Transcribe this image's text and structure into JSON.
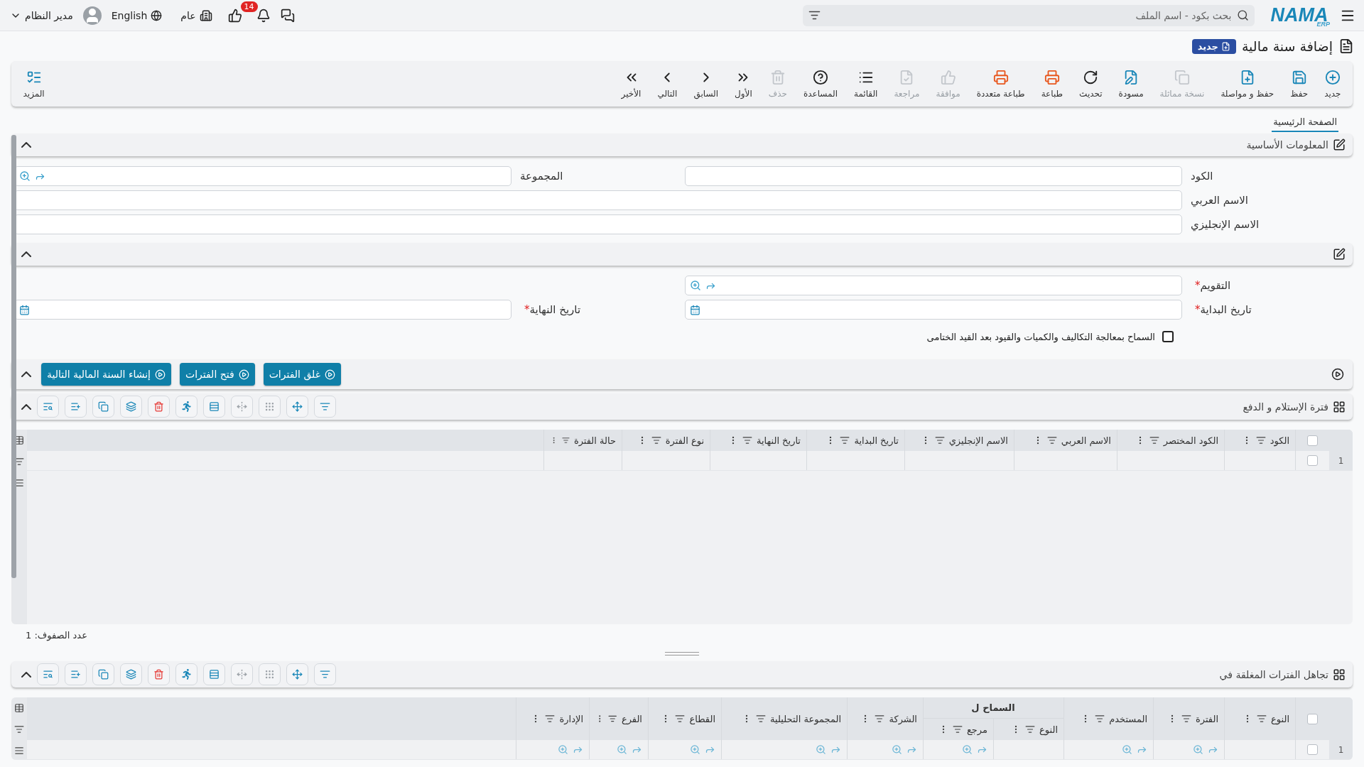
{
  "topbar": {
    "logo": "NAMA",
    "logo_sub": "ERP",
    "search_placeholder": "بحث بكود - اسم الملف",
    "notification_count": "14",
    "company": "عام",
    "language": "English",
    "user": "مدير النظام"
  },
  "page": {
    "title": "إضافة سنة مالية",
    "badge": "جديد"
  },
  "toolbar": [
    {
      "kind": "new",
      "label": "جديد",
      "disabled": false
    },
    {
      "kind": "save",
      "label": "حفظ",
      "disabled": false
    },
    {
      "kind": "save-continue",
      "label": "حفظ و مواصلة",
      "disabled": false
    },
    {
      "kind": "duplicate",
      "label": "نسخة مماثلة",
      "disabled": true
    },
    {
      "kind": "draft",
      "label": "مسودة",
      "disabled": false
    },
    {
      "kind": "refresh",
      "label": "تحديث",
      "disabled": false
    },
    {
      "kind": "print",
      "label": "طباعة",
      "disabled": false
    },
    {
      "kind": "multi-print",
      "label": "طباعة متعددة",
      "disabled": false
    },
    {
      "kind": "approve",
      "label": "موافقة",
      "disabled": true
    },
    {
      "kind": "review",
      "label": "مراجعة",
      "disabled": true
    },
    {
      "kind": "list",
      "label": "القائمة",
      "disabled": false
    },
    {
      "kind": "help",
      "label": "المساعدة",
      "disabled": false
    },
    {
      "kind": "delete",
      "label": "حذف",
      "disabled": true
    },
    {
      "kind": "first",
      "label": "الأول",
      "disabled": false
    },
    {
      "kind": "previous",
      "label": "السابق",
      "disabled": false
    },
    {
      "kind": "next",
      "label": "التالي",
      "disabled": false
    },
    {
      "kind": "last",
      "label": "الأخير",
      "disabled": false
    }
  ],
  "more": "المزيد",
  "tabs": [
    {
      "label": "الصفحة الرئيسية",
      "selected": true
    }
  ],
  "basic_info": {
    "title": "المعلومات الأساسية",
    "expanded": true,
    "rows": [
      [
        {
          "label": "الكود",
          "kind": "text",
          "required": false
        },
        {
          "label": "المجموعة",
          "kind": "lookup",
          "required": false
        }
      ],
      [
        {
          "label": "الاسم العربي",
          "kind": "text",
          "required": false
        }
      ],
      [
        {
          "label": "الاسم الإنجليزي",
          "kind": "text",
          "required": false
        }
      ]
    ]
  },
  "period_info": {
    "expanded": true,
    "rows": [
      [
        {
          "label": "التقويم",
          "kind": "lookup",
          "required": true,
          "mark": "*"
        }
      ],
      [
        {
          "label": "تاريخ البداية",
          "kind": "date",
          "required": true,
          "mark": "*"
        },
        {
          "label": "تاريخ النهاية",
          "kind": "date",
          "required": true,
          "mark": "*"
        }
      ]
    ],
    "checkbox": {
      "label": "السماح بمعالجة التكاليف والكميات والقيود بعد القيد الختامى",
      "checked": false
    }
  },
  "actions": {
    "expanded": true,
    "buttons": [
      "غلق الفترات",
      "فتح الفترات",
      "إنشاء السنة المالية التالية"
    ]
  },
  "periods_grid": {
    "title": "فترة الإستلام و الدفع",
    "expanded": true,
    "select_all": false,
    "columns": [
      {
        "label": "الكود",
        "kind": "text"
      },
      {
        "label": "الكود المختصر",
        "kind": "text"
      },
      {
        "label": "الاسم العربي",
        "kind": "text"
      },
      {
        "label": "الاسم الإنجليزي",
        "kind": "text"
      },
      {
        "label": "تاريخ البداية",
        "kind": "text"
      },
      {
        "label": "تاريخ النهاية",
        "kind": "text"
      },
      {
        "label": "نوع الفترة",
        "kind": "text"
      },
      {
        "label": "حالة الفترة",
        "kind": "text"
      }
    ],
    "rows": [
      {
        "number": "1",
        "checked": false
      }
    ],
    "row_count": "عدد الصفوف: 1"
  },
  "ignore_grid": {
    "title": "تجاهل الفترات المغلقة في",
    "expanded": true,
    "select_all": false,
    "columns": [
      {
        "label": "النوع",
        "kind": "text"
      },
      {
        "label": "الفترة",
        "kind": "lookup"
      },
      {
        "label": "المستخدم",
        "kind": "lookup"
      },
      {
        "group": "السماح ل",
        "children": [
          {
            "label": "النوع",
            "kind": "text"
          },
          {
            "label": "مرجع",
            "kind": "lookup"
          }
        ]
      },
      {
        "label": "الشركة",
        "kind": "lookup"
      },
      {
        "label": "المجموعة التحليلية",
        "kind": "lookup"
      },
      {
        "label": "القطاع",
        "kind": "lookup"
      },
      {
        "label": "الفرع",
        "kind": "lookup"
      },
      {
        "label": "الإدارة",
        "kind": "lookup"
      }
    ],
    "rows": [
      {
        "number": "1",
        "checked": false
      }
    ]
  }
}
